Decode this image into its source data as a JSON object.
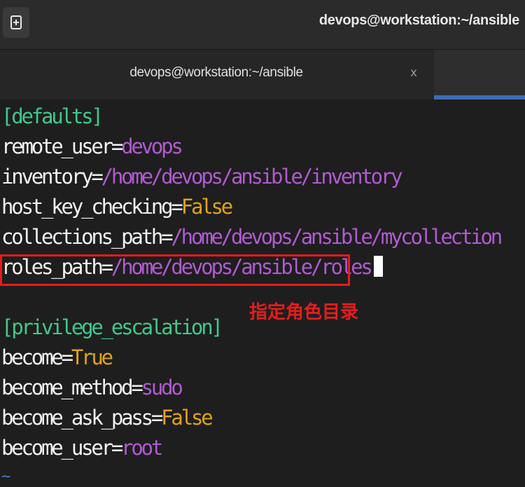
{
  "titlebar": {
    "title": "devops@workstation:~/ansible",
    "new_tab_icon": "new-tab-icon"
  },
  "tab": {
    "label": "devops@workstation:~/ansible",
    "close": "x"
  },
  "editor": {
    "lines": [
      {
        "section": "[defaults]"
      },
      {
        "key": "remote_user",
        "eq": "=",
        "value": "devops"
      },
      {
        "key": "inventory",
        "eq": "=",
        "value": "/home/devops/ansible/inventory"
      },
      {
        "key": "host_key_checking",
        "eq": "=",
        "value": "False"
      },
      {
        "key": "collections_path",
        "eq": "=",
        "value": "/home/devops/ansible/mycollection"
      },
      {
        "key": "roles_path",
        "eq": "=",
        "value": "/home/devops/ansible/roles"
      },
      {
        "section": "[privilege_escalation]"
      },
      {
        "key": "become",
        "eq": "=",
        "value": "True"
      },
      {
        "key": "become_method",
        "eq": "=",
        "value": "sudo"
      },
      {
        "key": "become_ask_pass",
        "eq": "=",
        "value": "False"
      },
      {
        "key": "become_user",
        "eq": "=",
        "value": "root"
      }
    ],
    "empty_line_marker": "~"
  },
  "annotation": {
    "text": "指定角色目录"
  },
  "colors": {
    "section": "#3ec98b",
    "value": "#b15ad1",
    "boolean": "#e0a317",
    "annotation": "#e51c1c",
    "tab_indicator": "#3b6fb6"
  }
}
